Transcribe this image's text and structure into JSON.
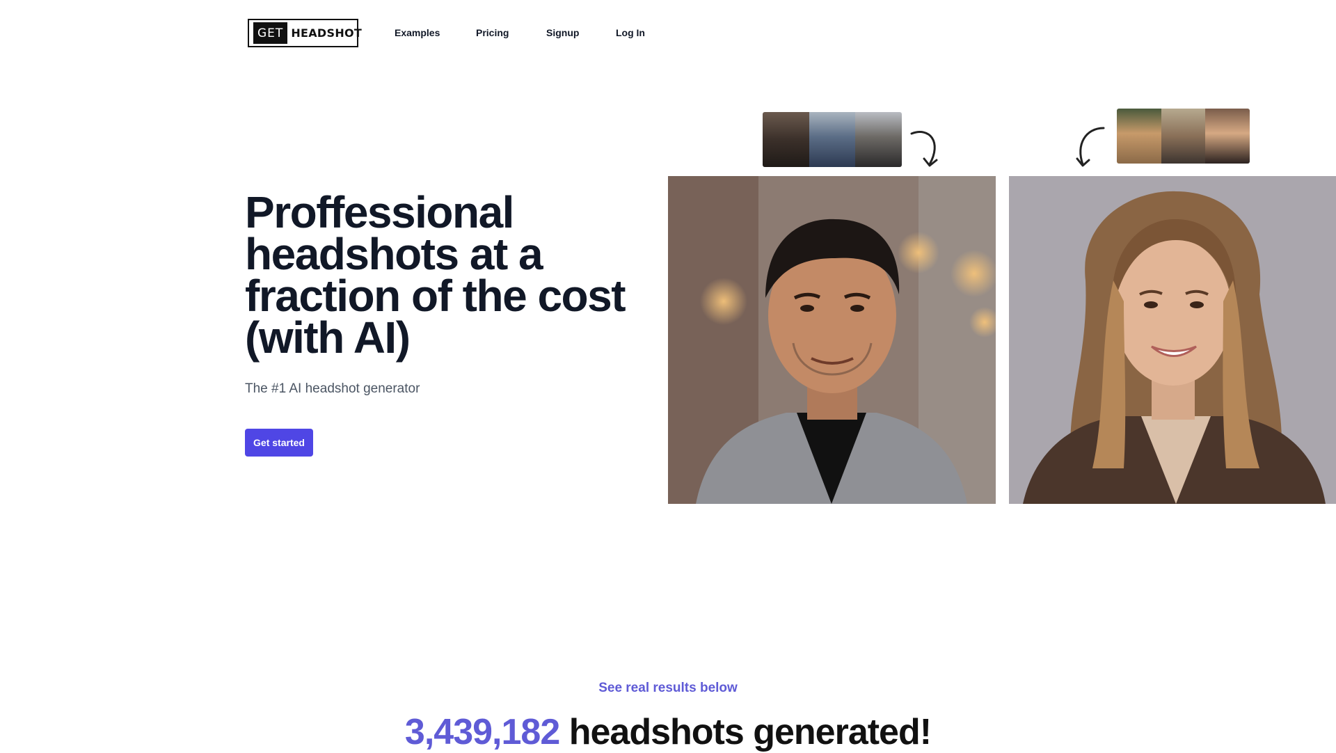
{
  "nav": {
    "logo_get": "GET",
    "logo_headshot": "HEADSHOT",
    "links": [
      "Examples",
      "Pricing",
      "Signup",
      "Log In"
    ]
  },
  "hero": {
    "title_lines": [
      "Proffessional",
      "headshots at a",
      "fraction of the cost",
      "(with AI)"
    ],
    "subtitle": "The #1 AI headshot generator",
    "cta_label": "Get started"
  },
  "stats": {
    "eyebrow": "See real results below",
    "count": "3,439,182",
    "count_suffix": " headshots generated!"
  },
  "colors": {
    "accent": "#4f46e5",
    "accent_text": "#5f5bd6",
    "heading": "#111827"
  },
  "icons": {
    "arrow_left": "curved-arrow-down-right-icon",
    "arrow_right": "curved-arrow-down-left-icon"
  }
}
